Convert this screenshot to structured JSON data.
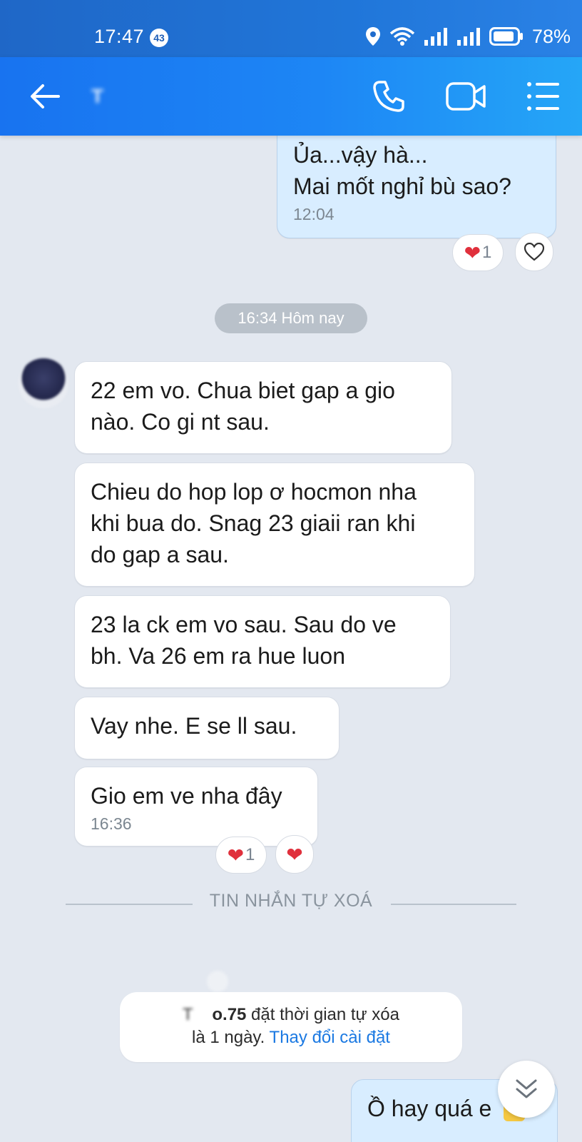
{
  "status_bar": {
    "time": "17:47",
    "notification_count": "43",
    "battery": "78%"
  },
  "header": {
    "contact_name": "T"
  },
  "messages": [
    {
      "side": "mine",
      "text": [
        "Ủa...vậy hà...",
        "Mai mốt nghỉ bù sao?"
      ],
      "time": "12:04",
      "reaction_count": "1"
    },
    {
      "side": "theirs",
      "text": [
        "22 em vo. Chua biet gap a gio",
        "nào. Co gi nt sau."
      ]
    },
    {
      "side": "theirs",
      "text": [
        "Chieu do hop lop ơ hocmon nha",
        "khi bua do. Snag 23 giaii ran khi",
        "do gap a sau."
      ]
    },
    {
      "side": "theirs",
      "text": [
        "23 la ck em vo sau. Sau do ve",
        "bh. Va 26 em ra hue luon"
      ]
    },
    {
      "side": "theirs",
      "text": [
        "Vay nhe. E se ll sau."
      ]
    },
    {
      "side": "theirs",
      "text": [
        "Gio em ve nha đây"
      ],
      "time": "16:36",
      "reaction_count": "1"
    },
    {
      "side": "mine",
      "text": [
        "Ồ hay quá e"
      ]
    }
  ],
  "date_separator": "16:34 Hôm nay",
  "self_destruct_divider": "TIN NHẮN TỰ XOÁ",
  "system_notice": {
    "name_prefix": "T",
    "name_suffix": "o.75",
    "line1_rest": " đặt thời gian tự xóa",
    "line2": "là 1 ngày. ",
    "link": "Thay đổi cài đặt"
  },
  "colors": {
    "header_start": "#1873f0",
    "header_end": "#25a6f7",
    "chat_bg": "#e3e8f0",
    "mine_bubble": "#d8edff",
    "link": "#1b79e2",
    "heart": "#e0303c"
  },
  "icons": [
    "back-arrow-icon",
    "phone-icon",
    "video-camera-icon",
    "menu-list-icon",
    "heart-icon",
    "heart-outline-icon",
    "chevron-double-down-icon",
    "location-icon",
    "wifi-icon",
    "signal-icon",
    "battery-icon"
  ]
}
